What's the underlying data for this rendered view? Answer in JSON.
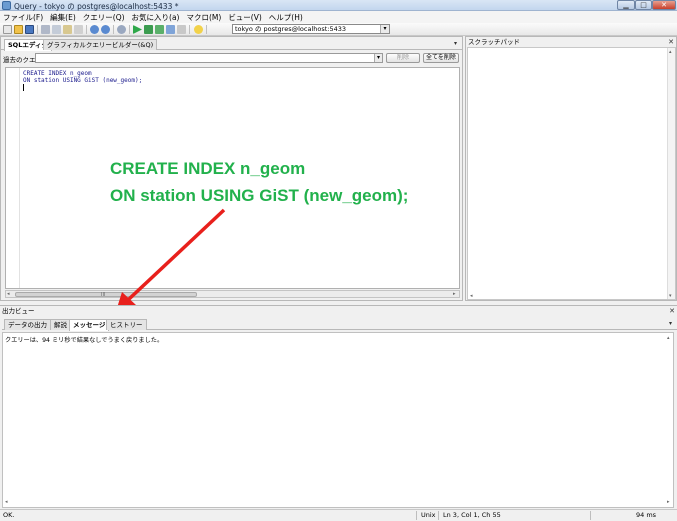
{
  "window": {
    "title": "Query - tokyo の postgres@localhost:5433 *",
    "minimize_glyph": "▁",
    "maximize_glyph": "□",
    "close_glyph": "✕"
  },
  "menu": [
    "ファイル(F)",
    "編集(E)",
    "クエリー(Q)",
    "お気に入り(a)",
    "マクロ(M)",
    "ビュー(V)",
    "ヘルプ(H)"
  ],
  "toolbar": {
    "connection": "tokyo の postgres@localhost:5433",
    "dropdown_glyph": "▾"
  },
  "editor": {
    "tabs": [
      "SQLエディタ",
      "グラフィカルクエリービルダー(&Q)"
    ],
    "history_label": "過去のクエリ",
    "delete_label": "削除",
    "delete_all_label": "全てを削除",
    "code_lines": [
      "CREATE INDEX n_geom",
      "ON station USING GiST (new_geom);"
    ],
    "scroll_left": "◂",
    "scroll_right": "▸",
    "thumb_grip": "III"
  },
  "scratchpad": {
    "title": "スクラッチパッド",
    "close_glyph": "✕",
    "scroll_up": "▴",
    "scroll_down": "▾"
  },
  "annotation": {
    "line1": "CREATE INDEX n_geom",
    "line2": "ON station USING GiST (new_geom);",
    "color": "#22b14c",
    "arrow_color": "#e8201c"
  },
  "output": {
    "title": "出力ビュー",
    "close_glyph": "✕",
    "tabs": [
      "データの出力",
      "解説",
      "メッセージ",
      "ヒストリー"
    ],
    "active_tab_index": 2,
    "message": "クエリーは、94 ミリ秒で結果なしでうまく戻りました。"
  },
  "statusbar": {
    "status": "OK.",
    "line_ending": "Unix",
    "position": "Ln 3, Col 1, Ch 55",
    "duration": "94 ms"
  }
}
